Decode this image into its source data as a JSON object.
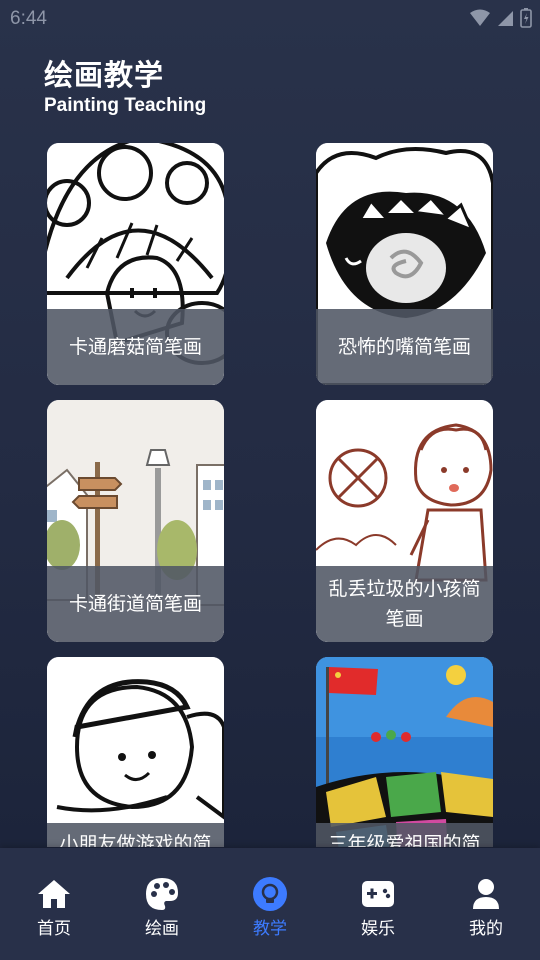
{
  "status_bar": {
    "time": "6:44"
  },
  "header": {
    "title": "绘画教学",
    "subtitle": "Painting Teaching"
  },
  "cards": [
    {
      "label": "卡通磨菇简笔画"
    },
    {
      "label": "恐怖的嘴简笔画"
    },
    {
      "label": "卡通街道简笔画"
    },
    {
      "label": "乱丢垃圾的小孩简笔画"
    },
    {
      "label": "小朋友做游戏的简"
    },
    {
      "label": "三年级爱祖国的简"
    }
  ],
  "nav": {
    "items": [
      {
        "label": "首页",
        "icon": "home-icon"
      },
      {
        "label": "绘画",
        "icon": "palette-icon"
      },
      {
        "label": "教学",
        "icon": "lightbulb-icon",
        "active": true
      },
      {
        "label": "娱乐",
        "icon": "gamepad-icon"
      },
      {
        "label": "我的",
        "icon": "user-icon"
      }
    ]
  },
  "colors": {
    "accent": "#3d7bff",
    "background": "#232b43",
    "nav_bg": "#283049",
    "label_overlay": "#505664"
  }
}
